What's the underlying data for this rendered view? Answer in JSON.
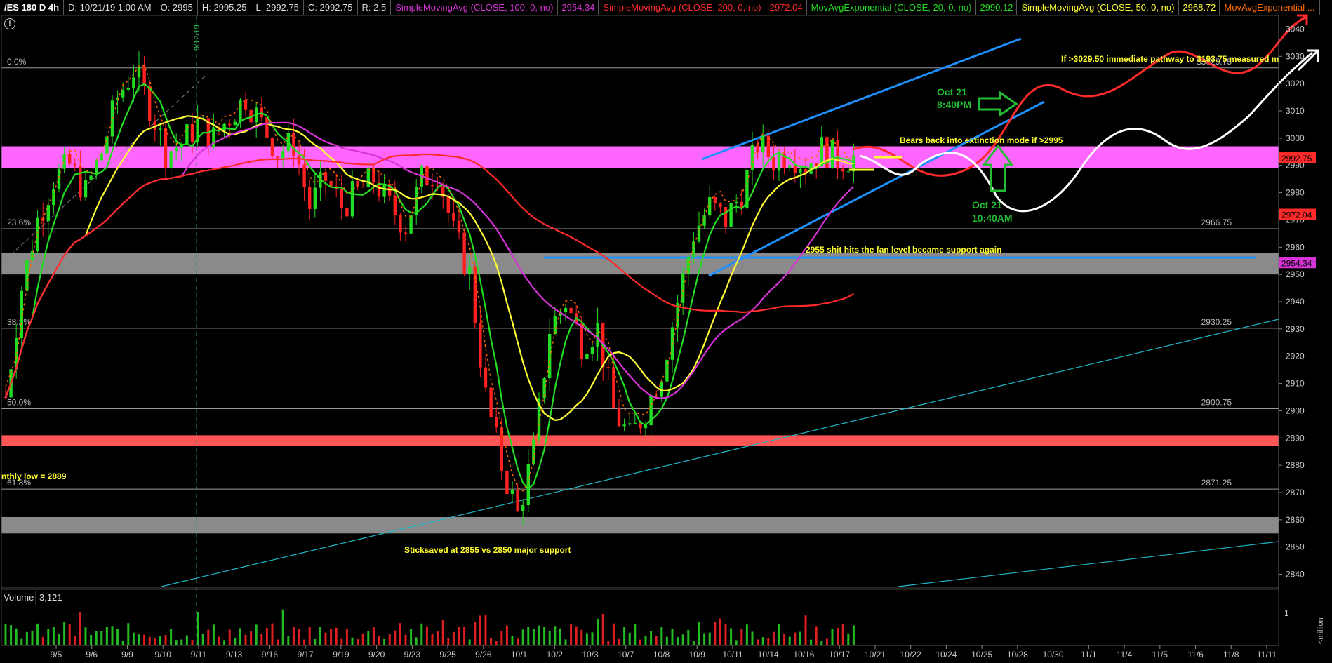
{
  "header": {
    "symbol": "/ES 180 D 4h",
    "date": "D: 10/21/19 1:00 AM",
    "open": "O: 2995",
    "high": "H: 2995.25",
    "low": "L: 2992.75",
    "close": "C: 2992.75",
    "range": "R: 2.5",
    "indicators": [
      {
        "label": "SimpleMovingAvg (CLOSE, 100, 0, no)",
        "value": "2954.34",
        "color": "#d633d6"
      },
      {
        "label": "SimpleMovingAvg (CLOSE, 200, 0, no)",
        "value": "2972.04",
        "color": "#ff2a2a"
      },
      {
        "label": "MovAvgExponential (CLOSE, 20, 0, no)",
        "value": "2990.12",
        "color": "#22dd22"
      },
      {
        "label": "SimpleMovingAvg (CLOSE, 50, 0, no)",
        "value": "2968.72",
        "color": "#ffff33"
      },
      {
        "label": "MovAvgExponential ...",
        "value": "",
        "color": "#ff6a00"
      }
    ]
  },
  "alert_icon": "exclamation-circle-icon",
  "chart_data": {
    "type": "candlestick",
    "symbol": "/ES",
    "timeframe": "4h",
    "ylim": [
      2835,
      3045
    ],
    "y_ticks": [
      2840,
      2850,
      2860,
      2870,
      2880,
      2890,
      2900,
      2910,
      2920,
      2930,
      2940,
      2950,
      2960,
      2970,
      2980,
      2990,
      3000,
      3010,
      3020,
      3030,
      3040
    ],
    "x_tick_labels": [
      "9/5",
      "9/6",
      "9/9",
      "9/10",
      "9/11",
      "9/13",
      "9/16",
      "9/17",
      "9/19",
      "9/20",
      "9/23",
      "9/25",
      "9/26",
      "10/1",
      "10/2",
      "10/3",
      "10/7",
      "10/8",
      "10/9",
      "10/11",
      "10/14",
      "10/16",
      "10/17",
      "10/21",
      "10/22",
      "10/24",
      "10/25",
      "10/28",
      "10/30",
      "11/1",
      "11/4",
      "11/5",
      "11/6",
      "11/8",
      "11/11"
    ],
    "price_path": [
      [
        0,
        2905
      ],
      [
        3,
        2945
      ],
      [
        6,
        2970
      ],
      [
        9,
        2985
      ],
      [
        12,
        2990
      ],
      [
        15,
        2980
      ],
      [
        18,
        2995
      ],
      [
        21,
        3015
      ],
      [
        24,
        3025
      ],
      [
        27,
        3012
      ],
      [
        30,
        2995
      ],
      [
        33,
        2998
      ],
      [
        36,
        3005
      ],
      [
        39,
        3000
      ],
      [
        42,
        3008
      ],
      [
        45,
        3015
      ],
      [
        48,
        3005
      ],
      [
        51,
        2995
      ],
      [
        54,
        2998
      ],
      [
        57,
        2975
      ],
      [
        60,
        2985
      ],
      [
        63,
        2975
      ],
      [
        66,
        2980
      ],
      [
        69,
        2985
      ],
      [
        72,
        2975
      ],
      [
        75,
        2968
      ],
      [
        78,
        2985
      ],
      [
        81,
        2988
      ],
      [
        84,
        2965
      ],
      [
        87,
        2950
      ],
      [
        90,
        2905
      ],
      [
        93,
        2880
      ],
      [
        96,
        2862
      ],
      [
        99,
        2885
      ],
      [
        102,
        2930
      ],
      [
        105,
        2940
      ],
      [
        108,
        2925
      ],
      [
        111,
        2930
      ],
      [
        114,
        2900
      ],
      [
        117,
        2890
      ],
      [
        120,
        2900
      ],
      [
        123,
        2915
      ],
      [
        126,
        2940
      ],
      [
        129,
        2965
      ],
      [
        132,
        2975
      ],
      [
        135,
        2970
      ],
      [
        138,
        2980
      ],
      [
        141,
        2998
      ],
      [
        144,
        2992
      ],
      [
        147,
        2995
      ],
      [
        150,
        2990
      ],
      [
        153,
        2996
      ],
      [
        156,
        2992
      ],
      [
        159,
        2993
      ]
    ],
    "moving_averages": [
      {
        "name": "SimpleMovingAvg (CLOSE, 100, 0, no)",
        "color": "#d633d6",
        "last": 2954.34
      },
      {
        "name": "SimpleMovingAvg (CLOSE, 200, 0, no)",
        "color": "#ff2a2a",
        "last": 2972.04
      },
      {
        "name": "MovAvgExponential (CLOSE, 20, 0, no)",
        "color": "#22dd22",
        "last": 2990.12
      },
      {
        "name": "SimpleMovingAvg (CLOSE, 50, 0, no)",
        "color": "#ffff33",
        "last": 2968.72
      }
    ],
    "fib_levels": [
      {
        "label": "0.0%",
        "price_label": "$3025.75",
        "price": 3025.75
      },
      {
        "label": "23.6%",
        "price_label": "2966.75",
        "price": 2966.75
      },
      {
        "label": "38.2%",
        "price_label": "2930.25",
        "price": 2930.25
      },
      {
        "label": "50.0%",
        "price_label": "2900.75",
        "price": 2900.75
      },
      {
        "label": "61.8%",
        "price_label": "2871.25",
        "price": 2871.25
      }
    ],
    "zones": [
      {
        "from": 2989,
        "to": 2997,
        "color": "#ff66ff"
      },
      {
        "from": 2950,
        "to": 2958,
        "color": "#8a8a8a"
      },
      {
        "from": 2887,
        "to": 2891,
        "color": "#ff5555"
      },
      {
        "from": 2855,
        "to": 2861,
        "color": "#8a8a8a"
      }
    ],
    "price_tags": [
      {
        "value": "2992.75",
        "price": 2992.75,
        "bg": "#ff2a2a",
        "fg": "#000"
      },
      {
        "value": "2972.04",
        "price": 2972.04,
        "bg": "#ff2a2a",
        "fg": "#000"
      },
      {
        "value": "2954.34",
        "price": 2954.34,
        "bg": "#d633d6",
        "fg": "#000"
      }
    ],
    "annotations": [
      {
        "text": "If >3029.50 immediate pathway to 3193.75 measured m",
        "color": "#ffff33"
      },
      {
        "text": "Bears back into extinction mode if >2995",
        "color": "#ffff33"
      },
      {
        "text": "2955 shit hits the fan level became support again",
        "color": "#ffff33"
      },
      {
        "text": "Sticksaved at 2855 vs 2850 major support",
        "color": "#ffff33"
      },
      {
        "text": "nthly low = 2889",
        "color": "#ffff33"
      },
      {
        "text": "Oct 21",
        "color": "#22bb33"
      },
      {
        "text": "8:40PM",
        "color": "#22bb33"
      },
      {
        "text": "Oct 21",
        "color": "#22bb33"
      },
      {
        "text": "10:40AM",
        "color": "#22bb33"
      },
      {
        "text": "9/12/19",
        "color": "#33bb55"
      }
    ],
    "volume": {
      "label": "Volume",
      "value": "3,121",
      "y_tick": "1",
      "unit_label": "<million"
    }
  }
}
